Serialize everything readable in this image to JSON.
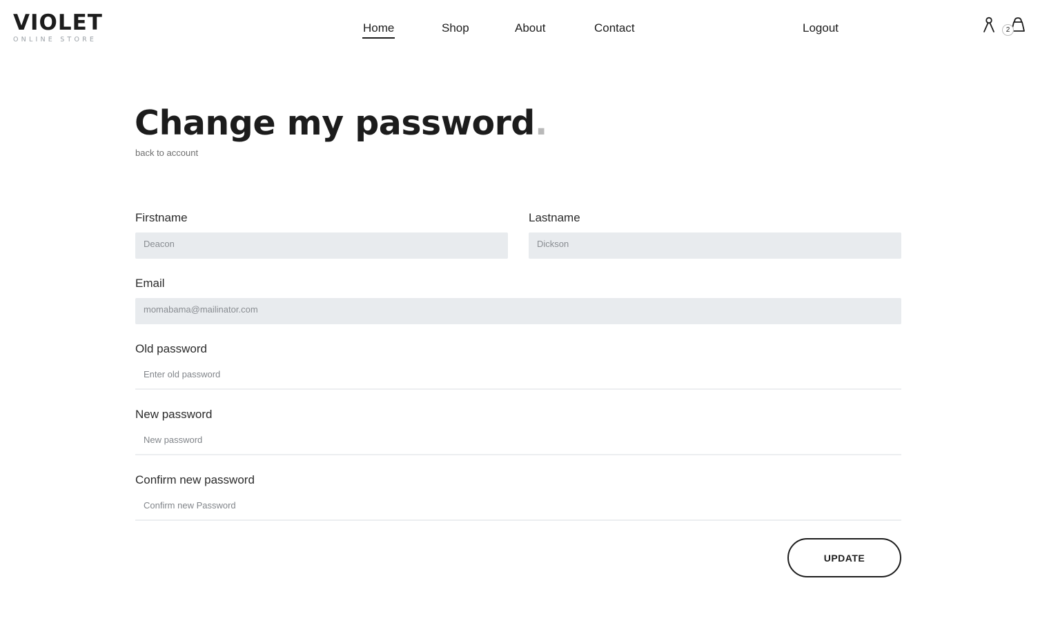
{
  "header": {
    "logo_title": "VIOLET",
    "logo_subtitle": "ONLINE STORE",
    "nav": {
      "home": "Home",
      "shop": "Shop",
      "about": "About",
      "contact": "Contact",
      "logout": "Logout"
    },
    "active_nav": "Home",
    "cart_count": "2",
    "icons": {
      "account": "user-icon",
      "cart": "shopping-bag-icon"
    }
  },
  "page": {
    "title": "Change my password",
    "title_dot": ".",
    "back_link": "back to account"
  },
  "form": {
    "firstname": {
      "label": "Firstname",
      "value": "Deacon"
    },
    "lastname": {
      "label": "Lastname",
      "value": "Dickson"
    },
    "email": {
      "label": "Email",
      "value": "momabama@mailinator.com"
    },
    "old_password": {
      "label": "Old password",
      "placeholder": "Enter old password"
    },
    "new_password": {
      "label": "New password",
      "placeholder": "New password"
    },
    "confirm_password": {
      "label": "Confirm new password",
      "placeholder": "Confirm new Password"
    },
    "submit_label": "UPDATE"
  },
  "colors": {
    "text": "#1c1c1c",
    "filled_input_bg": "#e8ebee",
    "muted": "#9aa0a6"
  }
}
